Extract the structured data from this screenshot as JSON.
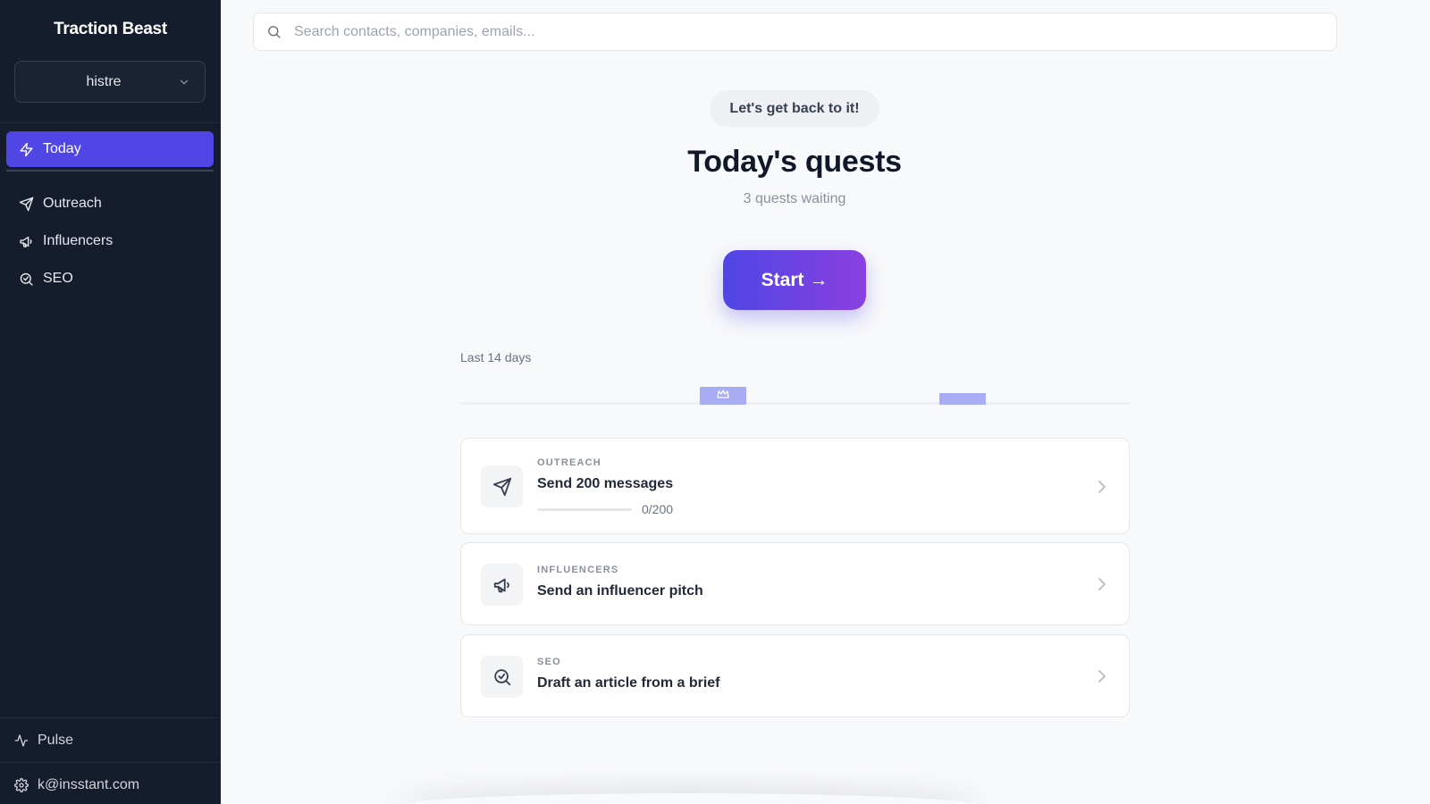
{
  "app": {
    "name": "Traction Beast"
  },
  "workspace": {
    "name": "histre"
  },
  "nav": {
    "items": [
      {
        "label": "Today",
        "icon": "bolt-icon",
        "active": true
      },
      {
        "label": "Outreach",
        "icon": "send-icon"
      },
      {
        "label": "Influencers",
        "icon": "megaphone-icon"
      },
      {
        "label": "SEO",
        "icon": "search-check-icon"
      }
    ]
  },
  "sidebar_bottom": {
    "pulse_label": "Pulse",
    "account_email": "k@insstant.com"
  },
  "search": {
    "placeholder": "Search contacts, companies, emails...",
    "value": ""
  },
  "hero": {
    "pill": "Let's get back to it!",
    "title": "Today's quests",
    "subtitle": "3 quests waiting",
    "start_label": "Start →"
  },
  "activity": {
    "label": "Last 14 days",
    "days": 14,
    "active_days": [
      {
        "index": 5,
        "level": 0.85,
        "crown": true
      },
      {
        "index": 10,
        "level": 0.55,
        "crown": false
      }
    ]
  },
  "quests": [
    {
      "category": "OUTREACH",
      "title": "Send 200 messages",
      "icon": "send-icon",
      "progress": {
        "current": 0,
        "total": 200,
        "text": "0/200"
      }
    },
    {
      "category": "INFLUENCERS",
      "title": "Send an influencer pitch",
      "icon": "megaphone-icon"
    },
    {
      "category": "SEO",
      "title": "Draft an article from a brief",
      "icon": "search-check-icon"
    }
  ],
  "colors": {
    "sidebar_bg": "#151c2c",
    "accent": "#4f46e5",
    "accent_gradient_end": "#8b3fe0",
    "activity_bar": "#a7acf3"
  }
}
